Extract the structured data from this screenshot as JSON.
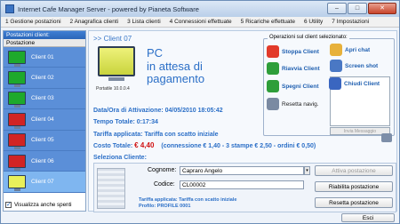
{
  "window": {
    "title": "Internet Cafe Manager Server - powered by Pianeta Software",
    "minimize": "–",
    "maximize": "□",
    "close": "✕"
  },
  "menu": [
    {
      "label": "1 Gestione postazioni"
    },
    {
      "label": "2 Anagrafica clienti"
    },
    {
      "label": "3 Lista clienti"
    },
    {
      "label": "4 Connessioni effettuate"
    },
    {
      "label": "5 Ricariche effettuate"
    },
    {
      "label": "6 Utility"
    },
    {
      "label": "7 Impostazioni"
    }
  ],
  "sidebar": {
    "header": "Postazioni client:",
    "column": "Postazione",
    "clients": [
      {
        "label": "Client 01",
        "color": "#1ea92c"
      },
      {
        "label": "Client 02",
        "color": "#1ea92c"
      },
      {
        "label": "Client 03",
        "color": "#1ea92c"
      },
      {
        "label": "Client 04",
        "color": "#d12424"
      },
      {
        "label": "Client 05",
        "color": "#d12424"
      },
      {
        "label": "Client 06",
        "color": "#d12424"
      },
      {
        "label": "Client 07",
        "color": "#e9f05b"
      }
    ],
    "show_off_label": "Visualizza anche spenti",
    "show_off_checked": true
  },
  "detail": {
    "client_title": ">> Client 07",
    "ip": "Portatile 10.0.0.4",
    "status_line1": "PC",
    "status_line2": "in attesa di",
    "status_line3": "pagamento",
    "activation": "Data/Ora di Attivazione: 04/05/2010 18:05:42",
    "total_time": "Tempo Totale: 0:17:34",
    "tariff": "Tariffa applicata: Tariffa con scatto iniziale",
    "cost_label": "Costo Totale:",
    "cost_value": "€ 4,40",
    "cost_detail": "(connessione € 1,40 - 3 stampe € 2,50 - ordini € 0,50)"
  },
  "operations": {
    "title": "Operazioni sul client selezionato:",
    "items": [
      {
        "label": "Stoppa Client",
        "icon": "stop-icon",
        "color": "#e23a2a"
      },
      {
        "label": "Riavvia Client",
        "icon": "restart-icon",
        "color": "#2e9e3a"
      },
      {
        "label": "Spegni Client",
        "icon": "power-icon",
        "color": "#2e9e3a"
      },
      {
        "label": "Resetta navig.",
        "icon": "reset-icon",
        "color": "#7a8aa2"
      },
      {
        "label": "Apri chat",
        "icon": "chat-icon",
        "color": "#e7b13b"
      },
      {
        "label": "Screen shot",
        "icon": "screenshot-icon",
        "color": "#4a78c4"
      },
      {
        "label": "Chiudi Client",
        "icon": "close-client-icon",
        "color": "#3a66c0"
      }
    ],
    "send_message": "Invia Messaggio"
  },
  "select": {
    "title": "Seleziona Cliente:",
    "surname_label": "Cognome:",
    "surname_value": "Capraro Angelo",
    "code_label": "Codice:",
    "code_value": "CL00002",
    "tariff_note_line1": "Tariffa applicata: Tariffa con scatto iniziale",
    "tariff_note_line2": "Profilo: PROFILE 0001",
    "btn_activate": "Attiva postazione",
    "btn_enable": "Riabilita postazione",
    "btn_reset": "Resetta postazione"
  },
  "footer": {
    "exit": "Esci"
  }
}
